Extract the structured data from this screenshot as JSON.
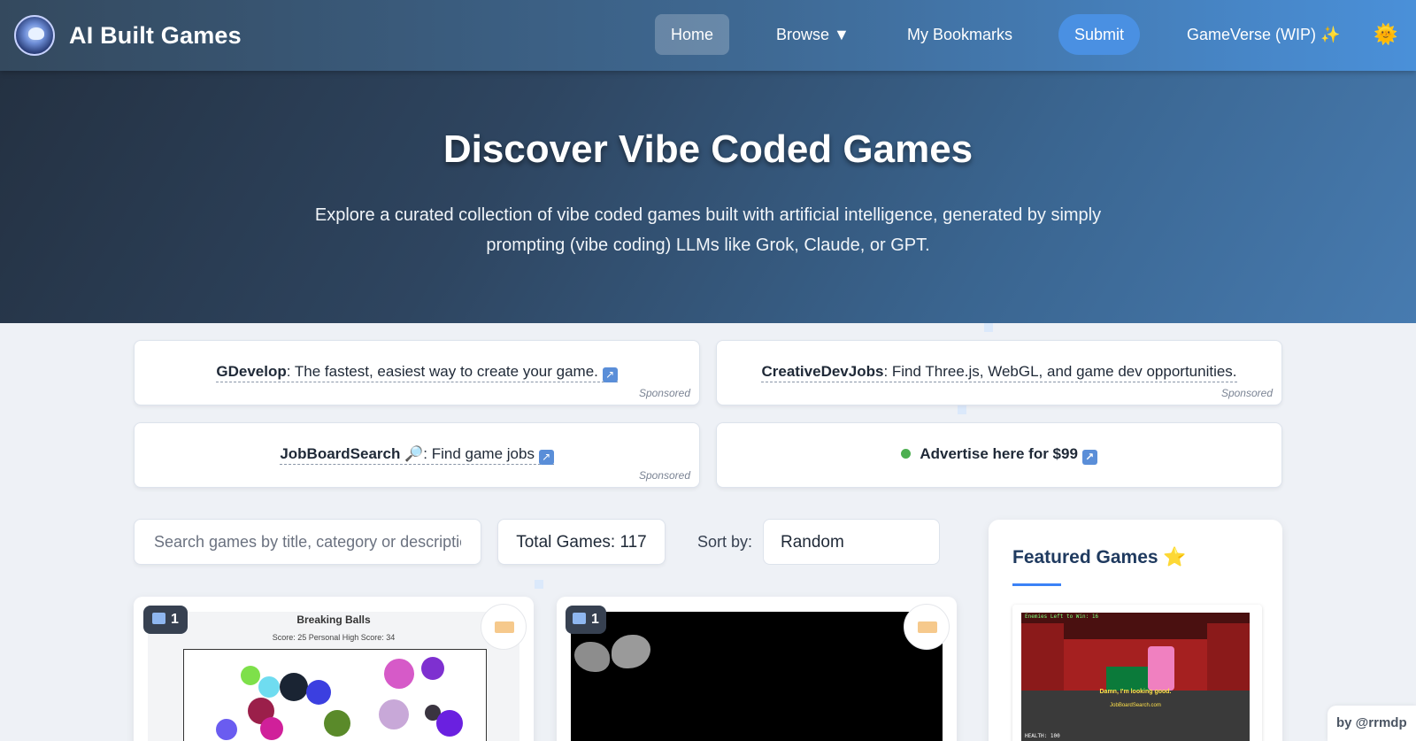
{
  "nav": {
    "brand": "AI Built Games",
    "items": {
      "home": "Home",
      "browse": "Browse ▼",
      "bookmarks": "My Bookmarks",
      "submit": "Submit",
      "gameverse": "GameVerse (WIP) ✨"
    },
    "theme_icon": "🌞"
  },
  "hero": {
    "title": "Discover Vibe Coded Games",
    "description": "Explore a curated collection of vibe coded games built with artificial intelligence, generated by simply prompting (vibe coding) LLMs like Grok, Claude, or GPT."
  },
  "sponsors": [
    {
      "name": "GDevelop",
      "text": ": The fastest, easiest way to create your game.",
      "ext_icon": "↗",
      "tag": "Sponsored"
    },
    {
      "name": "CreativeDevJobs",
      "text": ": Find Three.js, WebGL, and game dev opportunities.",
      "tag": "Sponsored"
    },
    {
      "name": "JobBoardSearch",
      "icon": "🔎",
      "text": ": Find game jobs",
      "ext_icon": "↗",
      "tag": "Sponsored"
    },
    {
      "text": "Advertise here for $99",
      "ext_icon": "↗"
    }
  ],
  "controls": {
    "search_placeholder": "Search games by title, category or description...",
    "total_games": "Total Games: 117",
    "sort_label": "Sort by:",
    "sort_value": "Random"
  },
  "games": [
    {
      "play_count": "1",
      "preview_title": "Breaking Balls",
      "preview_score": "Score: 25     Personal High Score: 34"
    },
    {
      "play_count": "1"
    }
  ],
  "featured": {
    "title": "Featured Games ⭐",
    "preview": {
      "top_text": "Enemies Left to Win: 16",
      "dialog": "Damn, I'm looking good.",
      "link": "JobBoardSearch.com",
      "health": "HEALTH: 100"
    }
  },
  "byline": "by @rrmdp"
}
